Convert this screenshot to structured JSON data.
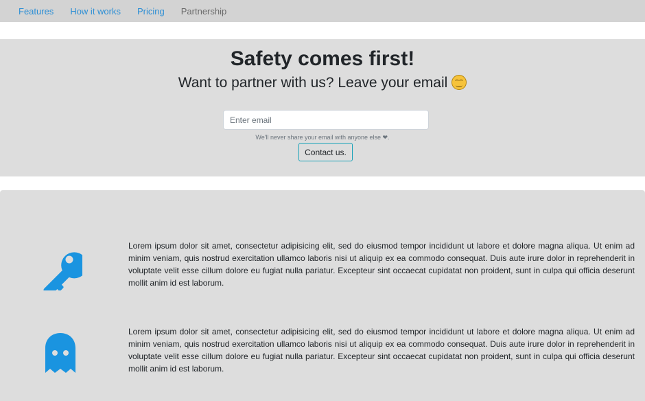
{
  "nav": {
    "items": [
      {
        "label": "Features"
      },
      {
        "label": "How it works"
      },
      {
        "label": "Pricing"
      },
      {
        "label": "Partnership"
      }
    ]
  },
  "hero": {
    "title": "Safety comes first!",
    "subtitle": "Want to partner with us? Leave your email",
    "email_placeholder": "Enter email",
    "help_text": "We'll never share your email with anyone else ❤.",
    "contact_label": "Contact us."
  },
  "features": {
    "items": [
      {
        "icon": "key-icon",
        "text": "Lorem ipsum dolor sit amet, consectetur adipisicing elit, sed do eiusmod tempor incididunt ut labore et dolore magna aliqua. Ut enim ad minim veniam, quis nostrud exercitation ullamco laboris nisi ut aliquip ex ea commodo consequat. Duis aute irure dolor in reprehenderit in voluptate velit esse cillum dolore eu fugiat nulla pariatur. Excepteur sint occaecat cupidatat non proident, sunt in culpa qui officia deserunt mollit anim id est laborum."
      },
      {
        "icon": "ghost-icon",
        "text": "Lorem ipsum dolor sit amet, consectetur adipisicing elit, sed do eiusmod tempor incididunt ut labore et dolore magna aliqua. Ut enim ad minim veniam, quis nostrud exercitation ullamco laboris nisi ut aliquip ex ea commodo consequat. Duis aute irure dolor in reprehenderit in voluptate velit esse cillum dolore eu fugiat nulla pariatur. Excepteur sint occaecat cupidatat non proident, sunt in culpa qui officia deserunt mollit anim id est laborum."
      }
    ]
  },
  "colors": {
    "accent": "#2d8fd5",
    "icon": "#1a94e0",
    "button_border": "#17a2b8",
    "section_bg": "#dddddd"
  }
}
